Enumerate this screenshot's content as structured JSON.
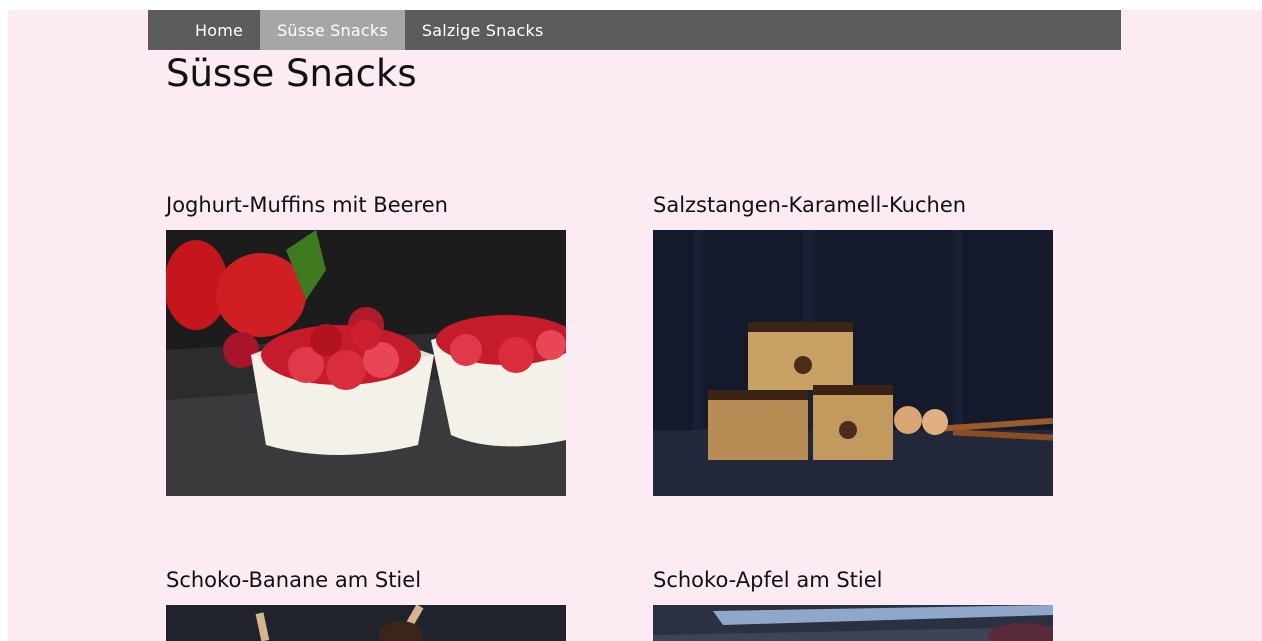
{
  "nav": {
    "items": [
      {
        "label": "Home",
        "active": false
      },
      {
        "label": "Süsse Snacks",
        "active": true
      },
      {
        "label": "Salzige Snacks",
        "active": false
      }
    ]
  },
  "page": {
    "title": "Süsse Snacks"
  },
  "recipes": [
    {
      "title": "Joghurt-Muffins mit Beeren",
      "image": "raspberry-muffins-photo"
    },
    {
      "title": "Salzstangen-Karamell-Kuchen",
      "image": "pretzel-caramel-cake-photo"
    },
    {
      "title": "Schoko-Banane am Stiel",
      "image": "chocolate-banana-pops-photo"
    },
    {
      "title": "Schoko-Apfel am Stiel",
      "image": "chocolate-apple-pops-photo"
    }
  ],
  "colors": {
    "background": "#fdebf3",
    "nav": "#5c5c5c",
    "nav_active": "#a6a6a6"
  }
}
